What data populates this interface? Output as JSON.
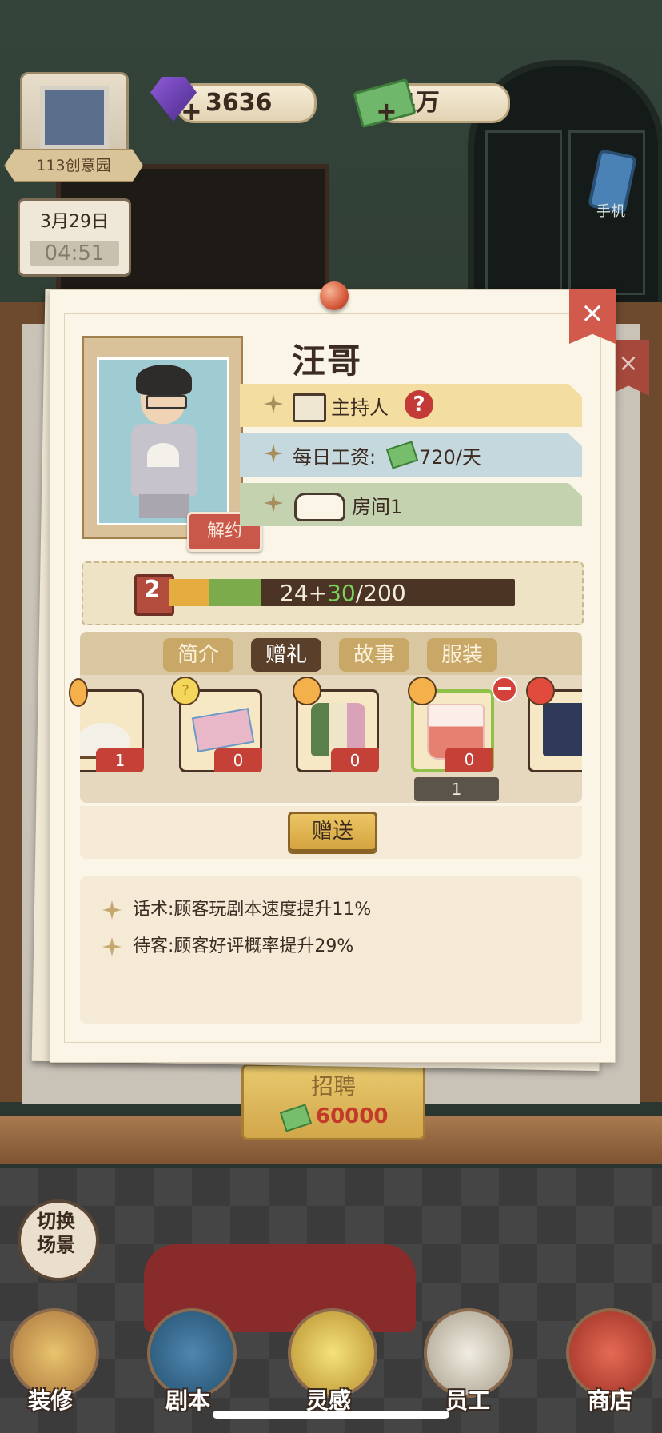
{
  "hud": {
    "gems": "3636",
    "cash": "4万",
    "gem_plus": "+",
    "cash_plus": "+",
    "location_name": "113创意园",
    "date": "3月29日",
    "time": "04:51",
    "phone_label": "手机"
  },
  "background": {
    "recruit_label": "招聘",
    "recruit_price": "60000"
  },
  "panel": {
    "close": "×",
    "staff_name": "汪哥",
    "terminate_label": "解约",
    "role": "主持人",
    "help": "?",
    "salary_label": "每日工资:",
    "salary_value": "720/天",
    "room": "房间1",
    "level": "2",
    "xp_current": "24",
    "xp_plus_sign": "+",
    "xp_gain": "30",
    "xp_max": "/200",
    "tabs": [
      "简介",
      "赠礼",
      "故事",
      "服装"
    ],
    "active_tab": "赠礼",
    "gifts": [
      {
        "name": "fan",
        "count": "1",
        "mood": "happy"
      },
      {
        "name": "ticket",
        "count": "0",
        "mood": "unknown"
      },
      {
        "name": "shampoo",
        "count": "0",
        "mood": "neutral"
      },
      {
        "name": "drink",
        "count": "0",
        "mood": "wink",
        "selected": true
      },
      {
        "name": "book",
        "count": "",
        "mood": "angry"
      }
    ],
    "selected_quantity": "1",
    "gift_button": "赠送",
    "skills": [
      "话术:顾客玩剧本速度提升11%",
      "待客:顾客好评概率提升29%"
    ]
  },
  "nav": {
    "switch_scene": "切换\n场景",
    "items": [
      "装修",
      "剧本",
      "灵感",
      "员工",
      "商店"
    ]
  },
  "colors": {
    "accent_red": "#c54036",
    "xp_green": "#79d35b",
    "tab_active": "#5a3f2a",
    "role_tab": "#f3dda0",
    "salary_tab": "#c5d8de",
    "room_tab": "#c4d2b0"
  }
}
